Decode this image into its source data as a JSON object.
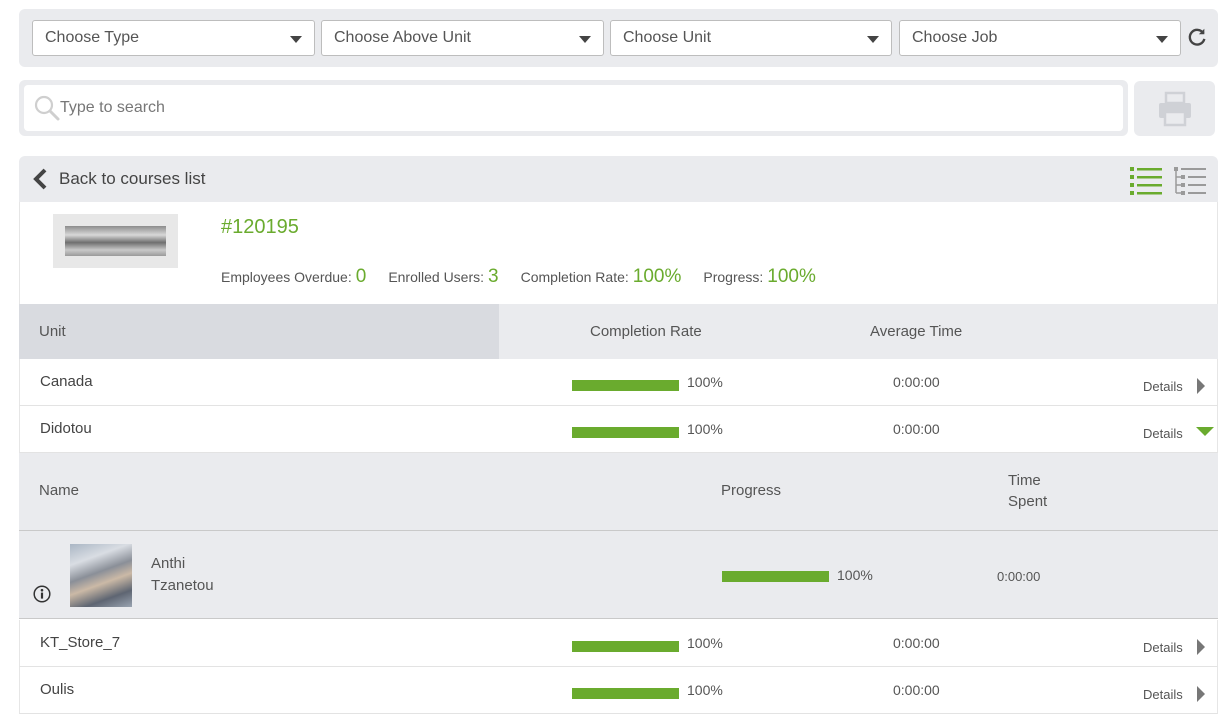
{
  "filters": {
    "type": "Choose Type",
    "above_unit": "Choose Above Unit",
    "unit": "Choose Unit",
    "job": "Choose Job"
  },
  "search": {
    "placeholder": "Type to search"
  },
  "panel": {
    "back_label": "Back to courses list",
    "course_id": "#120195",
    "stats": {
      "overdue_label": "Employees Overdue:",
      "overdue": "0",
      "enrolled_label": "Enrolled Users:",
      "enrolled": "3",
      "rate_label": "Completion Rate:",
      "rate": "100%",
      "progress_label": "Progress:",
      "progress": "100%"
    }
  },
  "table": {
    "headers": {
      "unit": "Unit",
      "rate": "Completion Rate",
      "time": "Average Time"
    },
    "details_label": "Details",
    "rows": [
      {
        "unit": "Canada",
        "rate": "100%",
        "rate_value": 100,
        "time": "0:00:00",
        "expanded": false
      },
      {
        "unit": "Didotou",
        "rate": "100%",
        "rate_value": 100,
        "time": "0:00:00",
        "expanded": true
      },
      {
        "unit": "KT_Store_7",
        "rate": "100%",
        "rate_value": 100,
        "time": "0:00:00",
        "expanded": false
      },
      {
        "unit": "Oulis",
        "rate": "100%",
        "rate_value": 100,
        "time": "0:00:00",
        "expanded": false
      }
    ]
  },
  "subtable": {
    "headers": {
      "name": "Name",
      "progress": "Progress",
      "time_line1": "Time",
      "time_line2": "Spent"
    },
    "employee": {
      "first_name": "Anthi",
      "last_name": "Tzanetou",
      "progress": "100%",
      "progress_value": 100,
      "time": "0:00:00"
    }
  },
  "colors": {
    "accent": "#6aab2e",
    "panel_bg": "#eaebee"
  }
}
